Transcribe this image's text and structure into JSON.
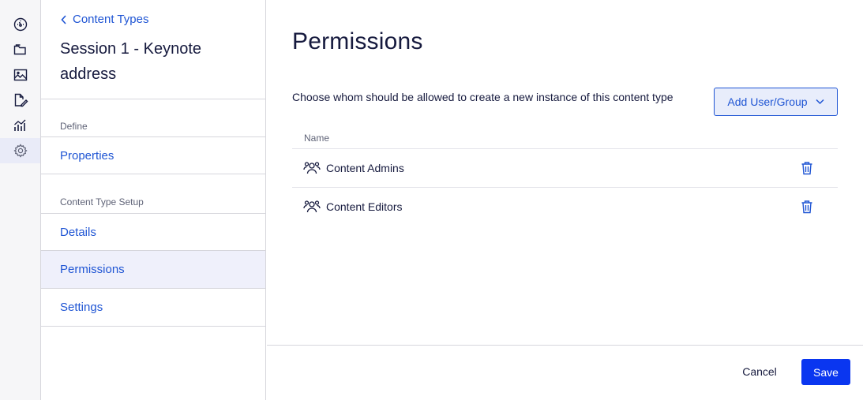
{
  "rail": {
    "items": [
      {
        "icon": "dashboard-icon"
      },
      {
        "icon": "folder-icon"
      },
      {
        "icon": "image-icon"
      },
      {
        "icon": "edit-document-icon"
      },
      {
        "icon": "analytics-icon"
      },
      {
        "icon": "gear-icon",
        "active": true
      }
    ]
  },
  "nav": {
    "back_label": "Content Types",
    "title": "Session 1 - Keynote address",
    "define_heading": "Define",
    "properties_label": "Properties",
    "setup_heading": "Content Type Setup",
    "details_label": "Details",
    "permissions_label": "Permissions",
    "settings_label": "Settings",
    "active_item": "Permissions"
  },
  "main": {
    "title": "Permissions",
    "description": "Choose whom should be allowed to create a new instance of this content type",
    "add_button_label": "Add User/Group",
    "column_name": "Name",
    "rows": [
      {
        "name": "Content Admins",
        "icon": "group-icon"
      },
      {
        "name": "Content Editors",
        "icon": "group-icon"
      }
    ]
  },
  "footer": {
    "cancel_label": "Cancel",
    "save_label": "Save"
  },
  "colors": {
    "accent": "#1f55d4",
    "primary_button": "#0a36f0",
    "active_bg": "#eff0fb",
    "text": "#161a3e"
  }
}
